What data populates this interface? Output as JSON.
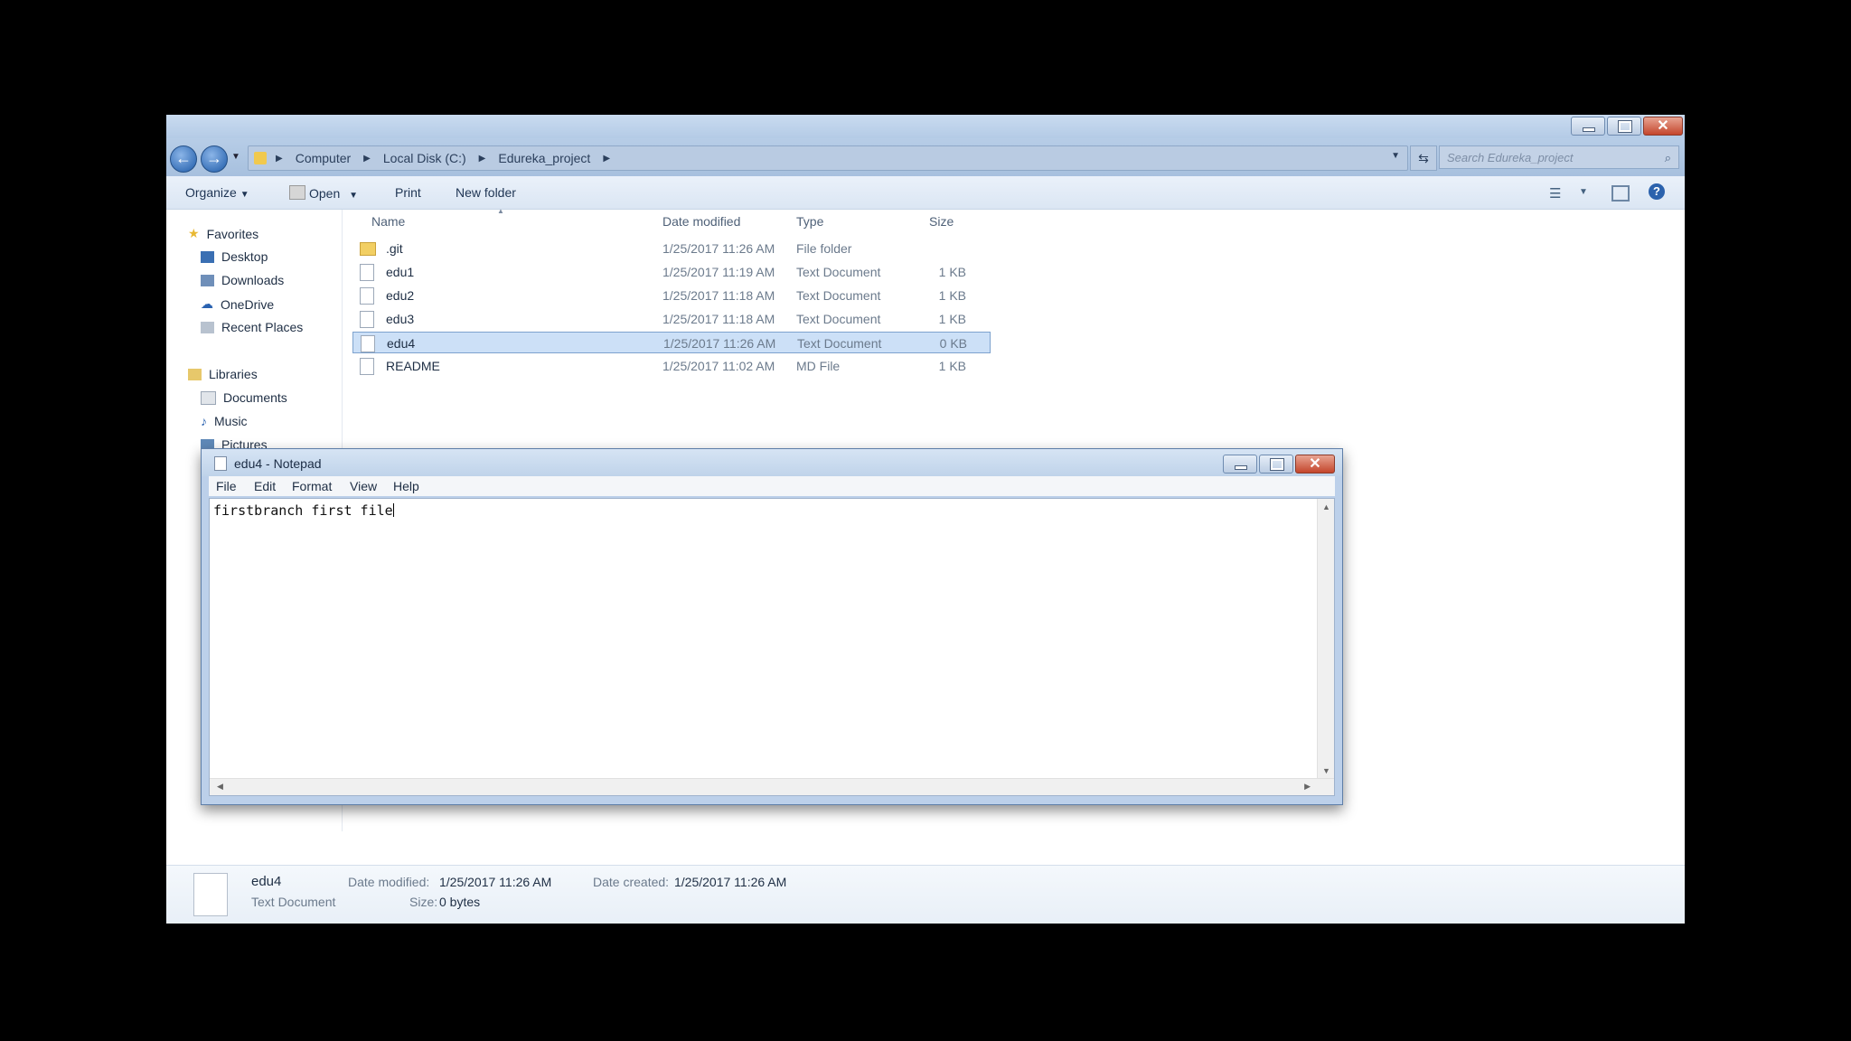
{
  "explorer": {
    "address": {
      "crumbs": [
        "Computer",
        "Local Disk (C:)",
        "Edureka_project"
      ],
      "search_placeholder": "Search Edureka_project"
    },
    "toolbar": {
      "organize": "Organize",
      "open": "Open",
      "print": "Print",
      "new_folder": "New folder"
    },
    "nav": {
      "favorites": "Favorites",
      "desktop": "Desktop",
      "downloads": "Downloads",
      "onedrive": "OneDrive",
      "recent_places": "Recent Places",
      "libraries": "Libraries",
      "documents": "Documents",
      "music": "Music",
      "pictures": "Pictures"
    },
    "columns": {
      "name": "Name",
      "date_modified": "Date modified",
      "type": "Type",
      "size": "Size"
    },
    "files": [
      {
        "name": ".git",
        "date": "1/25/2017 11:26 AM",
        "type": "File folder",
        "size": ""
      },
      {
        "name": "edu1",
        "date": "1/25/2017 11:19 AM",
        "type": "Text Document",
        "size": "1 KB"
      },
      {
        "name": "edu2",
        "date": "1/25/2017 11:18 AM",
        "type": "Text Document",
        "size": "1 KB"
      },
      {
        "name": "edu3",
        "date": "1/25/2017 11:18 AM",
        "type": "Text Document",
        "size": "1 KB"
      },
      {
        "name": "edu4",
        "date": "1/25/2017 11:26 AM",
        "type": "Text Document",
        "size": "0 KB"
      },
      {
        "name": "README",
        "date": "1/25/2017 11:02 AM",
        "type": "MD File",
        "size": "1 KB"
      }
    ],
    "details": {
      "name": "edu4",
      "type": "Text Document",
      "modified_label": "Date modified:",
      "modified_value": "1/25/2017 11:26 AM",
      "created_label": "Date created:",
      "created_value": "1/25/2017 11:26 AM",
      "size_label": "Size:",
      "size_value": "0 bytes"
    }
  },
  "notepad": {
    "title": "edu4 - Notepad",
    "menu": {
      "file": "File",
      "edit": "Edit",
      "format": "Format",
      "view": "View",
      "help": "Help"
    },
    "content": "firstbranch first file"
  }
}
